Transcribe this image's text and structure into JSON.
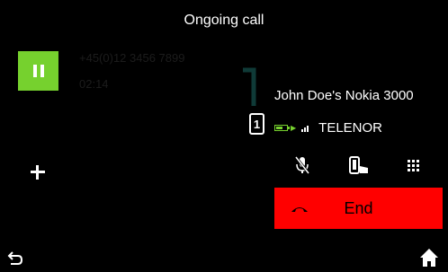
{
  "header": {
    "title": "Ongoing call"
  },
  "call": {
    "number": "+45(0)12 3456 7899",
    "duration": "02:14",
    "hold_icon": "pause-icon",
    "device_name": "John Doe's Nokia 3000",
    "operator": "TELENOR",
    "phone_number_badge": "1",
    "battery_level": 0.6,
    "signal_bars": 3
  },
  "actions": {
    "add_icon": "plus-icon",
    "mute_icon": "mic-muted-icon",
    "handover_icon": "phone-handover-icon",
    "keypad_icon": "keypad-icon",
    "end_label": "End",
    "end_icon": "hang-up-icon"
  },
  "nav": {
    "back_icon": "back-arrow-icon",
    "home_icon": "home-icon"
  },
  "colors": {
    "accent_green": "#76d12e",
    "end_red": "#ff0000",
    "background": "#000000"
  }
}
